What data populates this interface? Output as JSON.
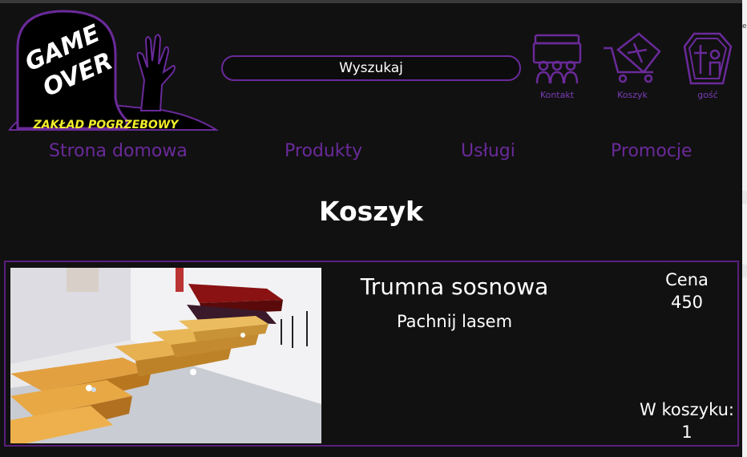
{
  "brand": {
    "logo_line1": "GAME",
    "logo_line2": "OVER",
    "tagline": "ZAKŁAD POGRZEBOWY"
  },
  "search": {
    "placeholder": "Wyszukaj"
  },
  "header_icons": [
    {
      "label": "Kontakt",
      "icon": "people-icon"
    },
    {
      "label": "Koszyk",
      "icon": "coffin-cart-icon"
    },
    {
      "label": "gość",
      "icon": "coffin-user-icon"
    }
  ],
  "nav": [
    "Strona domowa",
    "Produkty",
    "Usługi",
    "Promocje"
  ],
  "page": {
    "title": "Koszyk"
  },
  "cart_item": {
    "name": "Trumna sosnowa",
    "description": "Pachnij lasem",
    "price_label": "Cena",
    "price": "450",
    "qty_label": "W koszyku:",
    "qty": "1"
  },
  "colors": {
    "accent": "#6a2a9a",
    "logo_yellow": "#f2ee2a",
    "background": "#111111"
  }
}
